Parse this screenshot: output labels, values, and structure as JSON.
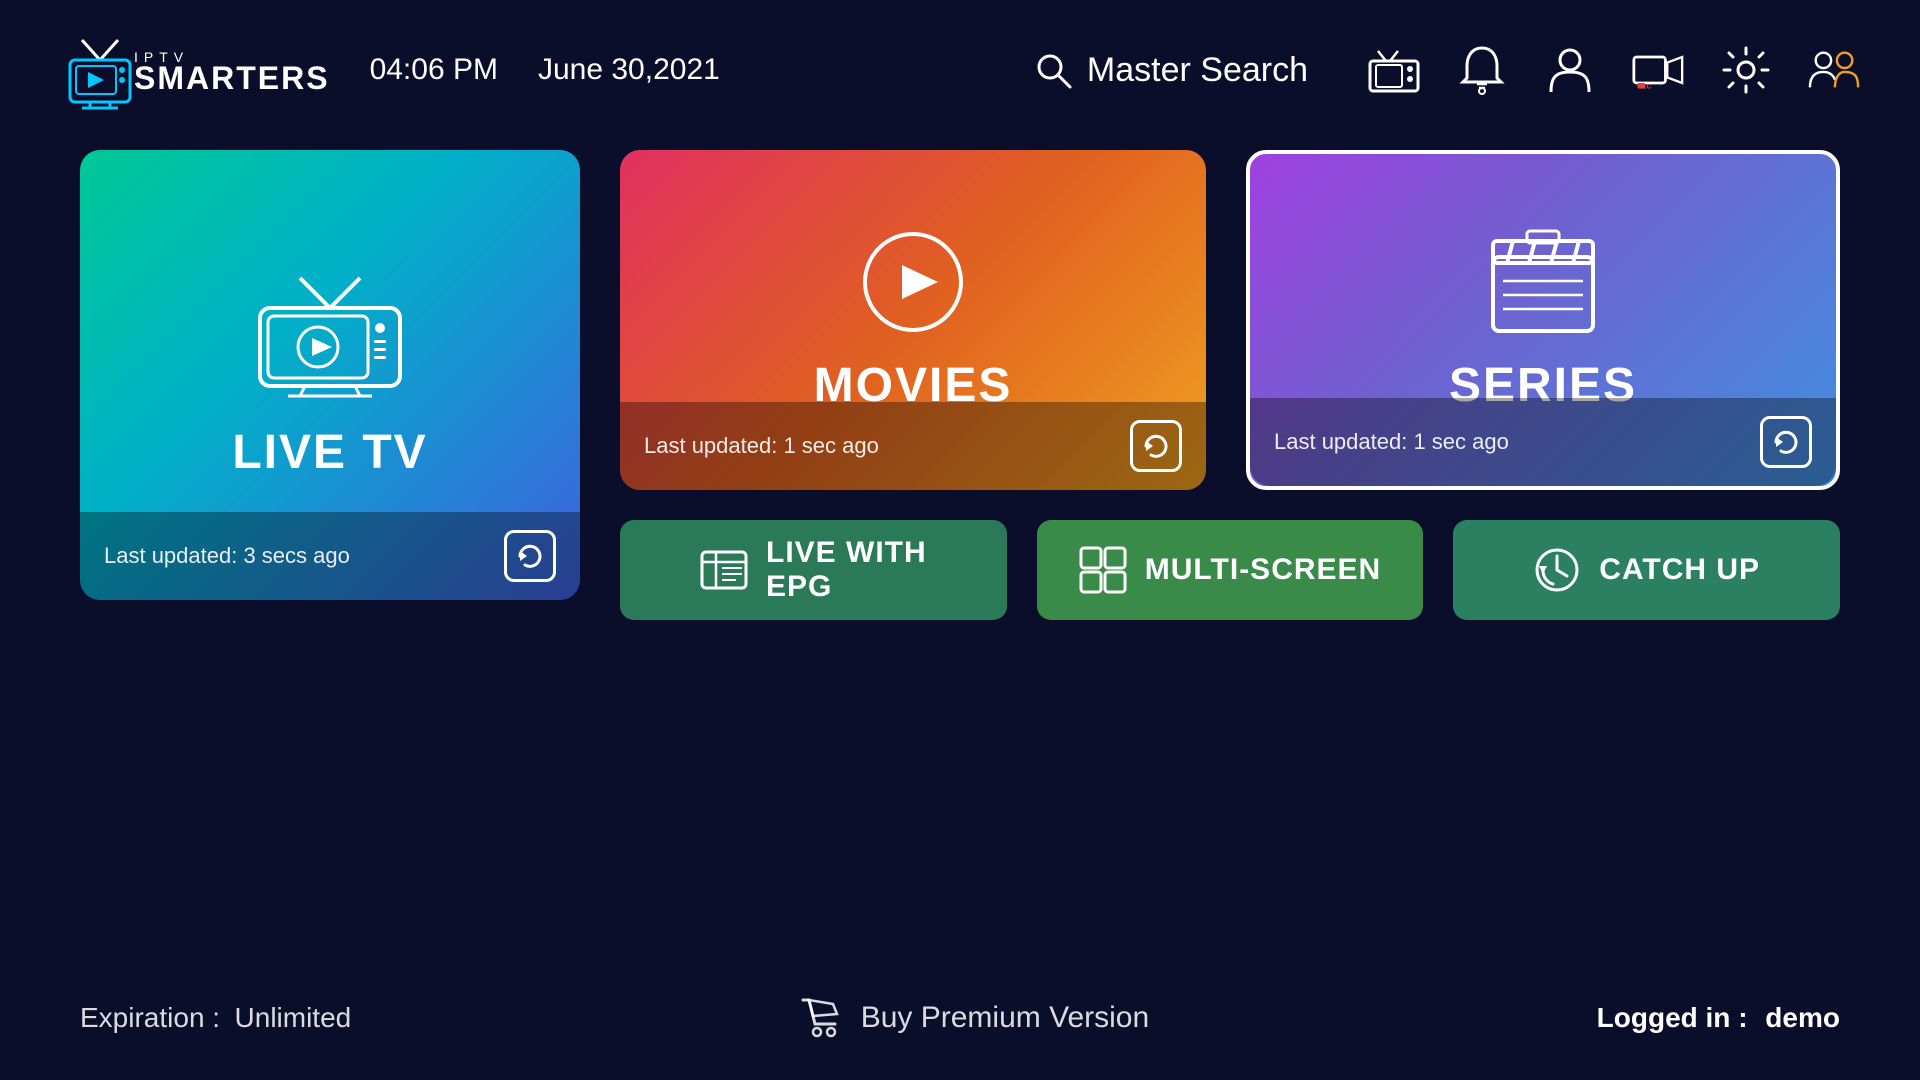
{
  "header": {
    "logo_text_light": "IPTV",
    "logo_text_bold": "SMARTERS",
    "time": "04:06 PM",
    "date": "June 30,2021",
    "search_label": "Master Search",
    "nav_icons": [
      "radio-icon",
      "bell-icon",
      "user-icon",
      "record-icon",
      "settings-icon",
      "switch-user-icon"
    ]
  },
  "cards": {
    "live_tv": {
      "title": "LIVE TV",
      "update_text": "Last updated: 3 secs ago",
      "refresh_label": "↺"
    },
    "movies": {
      "title": "MOVIES",
      "update_text": "Last updated: 1 sec ago",
      "refresh_label": "↺"
    },
    "series": {
      "title": "SERIES",
      "update_text": "Last updated: 1 sec ago",
      "refresh_label": "↺"
    }
  },
  "buttons": {
    "live_epg": "LIVE WITH\nEPG",
    "live_epg_line1": "LIVE WITH",
    "live_epg_line2": "EPG",
    "multi_screen": "MULTI-SCREEN",
    "catch_up": "CATCH UP"
  },
  "footer": {
    "expiration_label": "Expiration :",
    "expiration_value": "Unlimited",
    "buy_label": "Buy Premium Version",
    "logged_in_label": "Logged in :",
    "logged_in_user": "demo"
  }
}
